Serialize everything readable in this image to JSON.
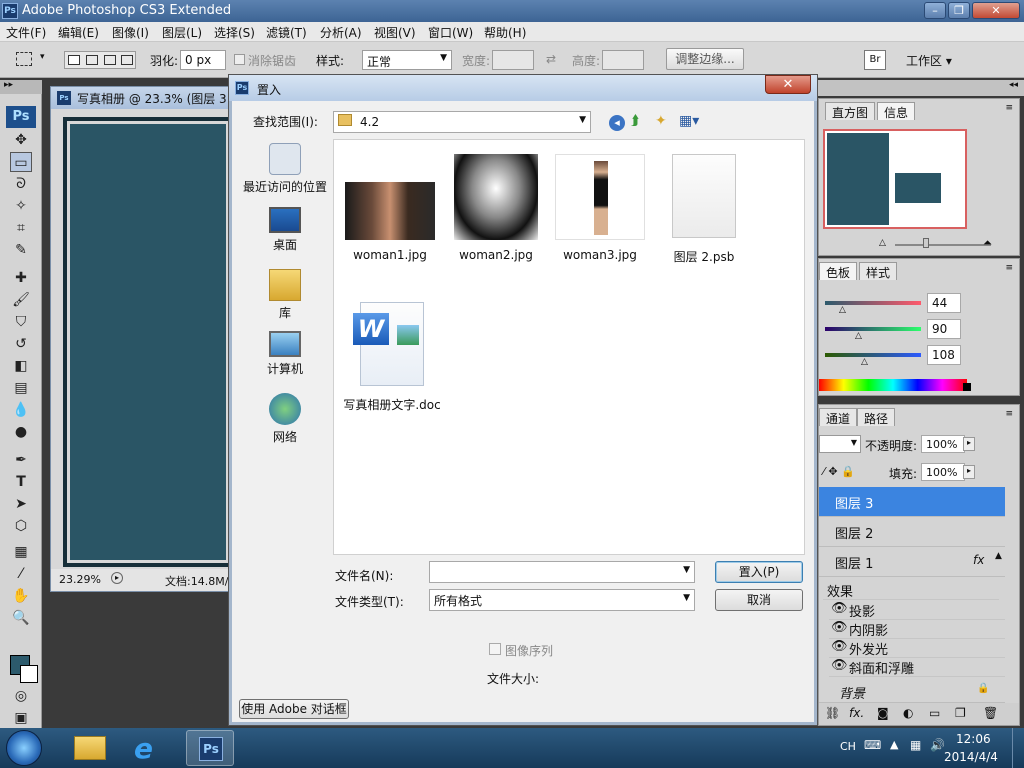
{
  "app": {
    "title": "Adobe Photoshop CS3 Extended",
    "logo": "Ps",
    "window_buttons": [
      "–",
      "❐",
      "✕"
    ]
  },
  "menu": [
    "文件(F)",
    "编辑(E)",
    "图像(I)",
    "图层(L)",
    "选择(S)",
    "滤镜(T)",
    "分析(A)",
    "视图(V)",
    "窗口(W)",
    "帮助(H)"
  ],
  "options": {
    "feather_label": "羽化:",
    "feather_value": "0 px",
    "antialias_label": "消除锯齿",
    "style_label": "样式:",
    "style_value": "正常",
    "width_label": "宽度:",
    "height_label": "高度:",
    "refine_button": "调整边缘...",
    "workspace_label": "工作区"
  },
  "document": {
    "title": "写真相册 @ 23.3% (图层 3",
    "zoom": "23.29%",
    "doc_size": "文档:14.8M/"
  },
  "navigator": {
    "tabs": [
      "直方图",
      "信息"
    ]
  },
  "color_panel": {
    "tabs": [
      "色板",
      "样式"
    ],
    "r": "44",
    "g": "90",
    "b": "108",
    "swatch": "#2c5a6c"
  },
  "layers_panel": {
    "tabs": [
      "通道",
      "路径"
    ],
    "opacity_label": "不透明度:",
    "opacity_value": "100%",
    "fill_label": "填充:",
    "fill_value": "100%",
    "layers": [
      "图层 3",
      "图层 2",
      "图层 1"
    ],
    "fx_badge": "fx",
    "effects_label": "效果",
    "effects": [
      "投影",
      "内阴影",
      "外发光",
      "斜面和浮雕"
    ],
    "background_layer": "背景",
    "footer_icons": [
      "link-icon",
      "fx-icon",
      "mask-icon",
      "adjustment-icon",
      "folder-icon",
      "new-layer-icon",
      "trash-icon"
    ],
    "footer_fx": "fx."
  },
  "dialog": {
    "title": "置入",
    "close_label": "✕",
    "look_in_label": "查找范围(I):",
    "look_in_value": "4.2",
    "places": [
      "最近访问的位置",
      "桌面",
      "库",
      "计算机",
      "网络"
    ],
    "files": [
      {
        "name": "woman1.jpg",
        "kind": "photo-color"
      },
      {
        "name": "woman2.jpg",
        "kind": "photo-bw"
      },
      {
        "name": "woman3.jpg",
        "kind": "photo-standing"
      },
      {
        "name": "图层 2.psb",
        "kind": "blank-doc"
      },
      {
        "name": "写真相册文字.doc",
        "kind": "word-doc"
      }
    ],
    "filename_label": "文件名(N):",
    "filename_value": "",
    "filetype_label": "文件类型(T):",
    "filetype_value": "所有格式",
    "place_button": "置入(P)",
    "cancel_button": "取消",
    "sequence_label": "图像序列",
    "filesize_label": "文件大小:",
    "adobe_dialog_button": "使用 Adobe 对话框"
  },
  "taskbar": {
    "lang": "CH",
    "time": "12:06",
    "date": "2014/4/4"
  }
}
